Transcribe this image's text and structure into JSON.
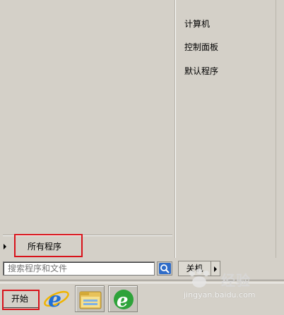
{
  "right_pane": {
    "items": [
      {
        "label": "计算机"
      },
      {
        "label": "控制面板"
      },
      {
        "label": "默认程序"
      }
    ]
  },
  "left_pane": {
    "all_programs_label": "所有程序"
  },
  "search": {
    "placeholder": "搜索程序和文件",
    "value": ""
  },
  "shutdown": {
    "label": "关机"
  },
  "taskbar": {
    "start_label": "开始",
    "pinned": [
      {
        "icon": "internet-explorer-icon"
      },
      {
        "icon": "windows-explorer-icon"
      },
      {
        "icon": "green-browser-icon"
      }
    ]
  },
  "watermark": {
    "brand": "经验",
    "url": "jingyan.baidu.com"
  },
  "colors": {
    "highlight_box": "#d8121a",
    "menu_bg": "#d4d0c8"
  }
}
